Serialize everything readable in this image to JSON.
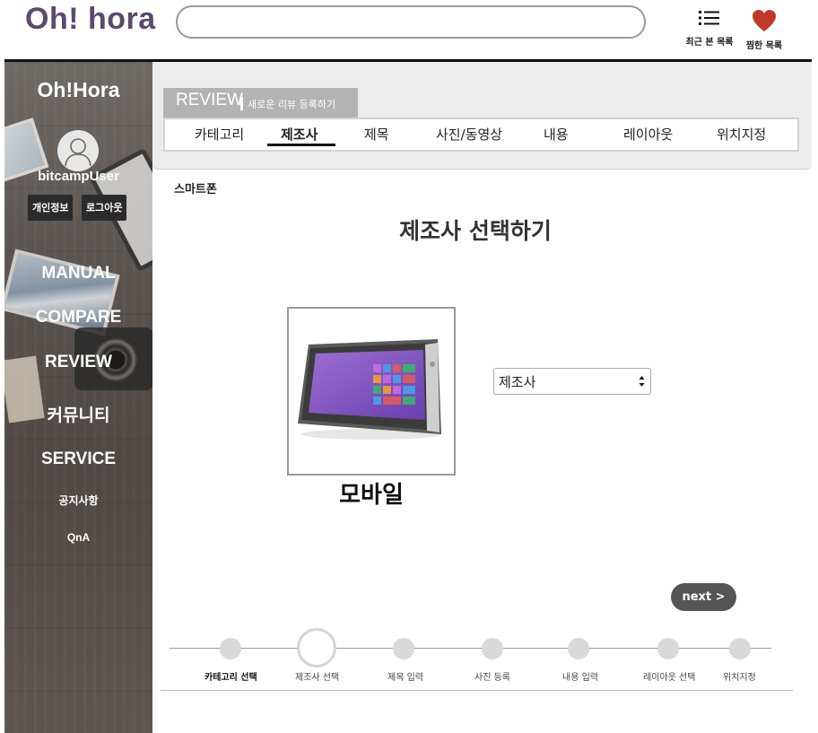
{
  "header": {
    "logo": "Oh! hora",
    "search_value": "",
    "recent_label": "최근 본 목록",
    "wish_label": "찜한 목록"
  },
  "sidebar": {
    "title": "Oh!Hora",
    "username": "bitcampUser",
    "profile_button": "개인정보",
    "logout_button": "로그아웃",
    "nav": [
      "MANUAL",
      "COMPARE",
      "REVIEW",
      "커뮤니티",
      "SERVICE"
    ],
    "sub_nav": [
      "공지사항",
      "QnA"
    ]
  },
  "review_header": {
    "title": "REVIEW",
    "subtitle": "새로운 리뷰 등록하기",
    "tabs": [
      "카테고리",
      "제조사",
      "제목",
      "사진/동영상",
      "내용",
      "레이아웃",
      "위치지정"
    ],
    "active_tab": "제조사"
  },
  "content": {
    "breadcrumb": "스마트폰",
    "heading": "제조사 선택하기",
    "product_label": "모바일",
    "select_value": "제조사",
    "next_button": "next >"
  },
  "steps": [
    "카테고리 선택",
    "제조사 선택",
    "제목 입력",
    "사진 등록",
    "내용 입력",
    "레이아웃 선택",
    "위치지정"
  ],
  "current_step": 1,
  "colors": {
    "logo": "#5c4a6e",
    "heart": "#c0392b",
    "accent_dark": "#555555"
  }
}
